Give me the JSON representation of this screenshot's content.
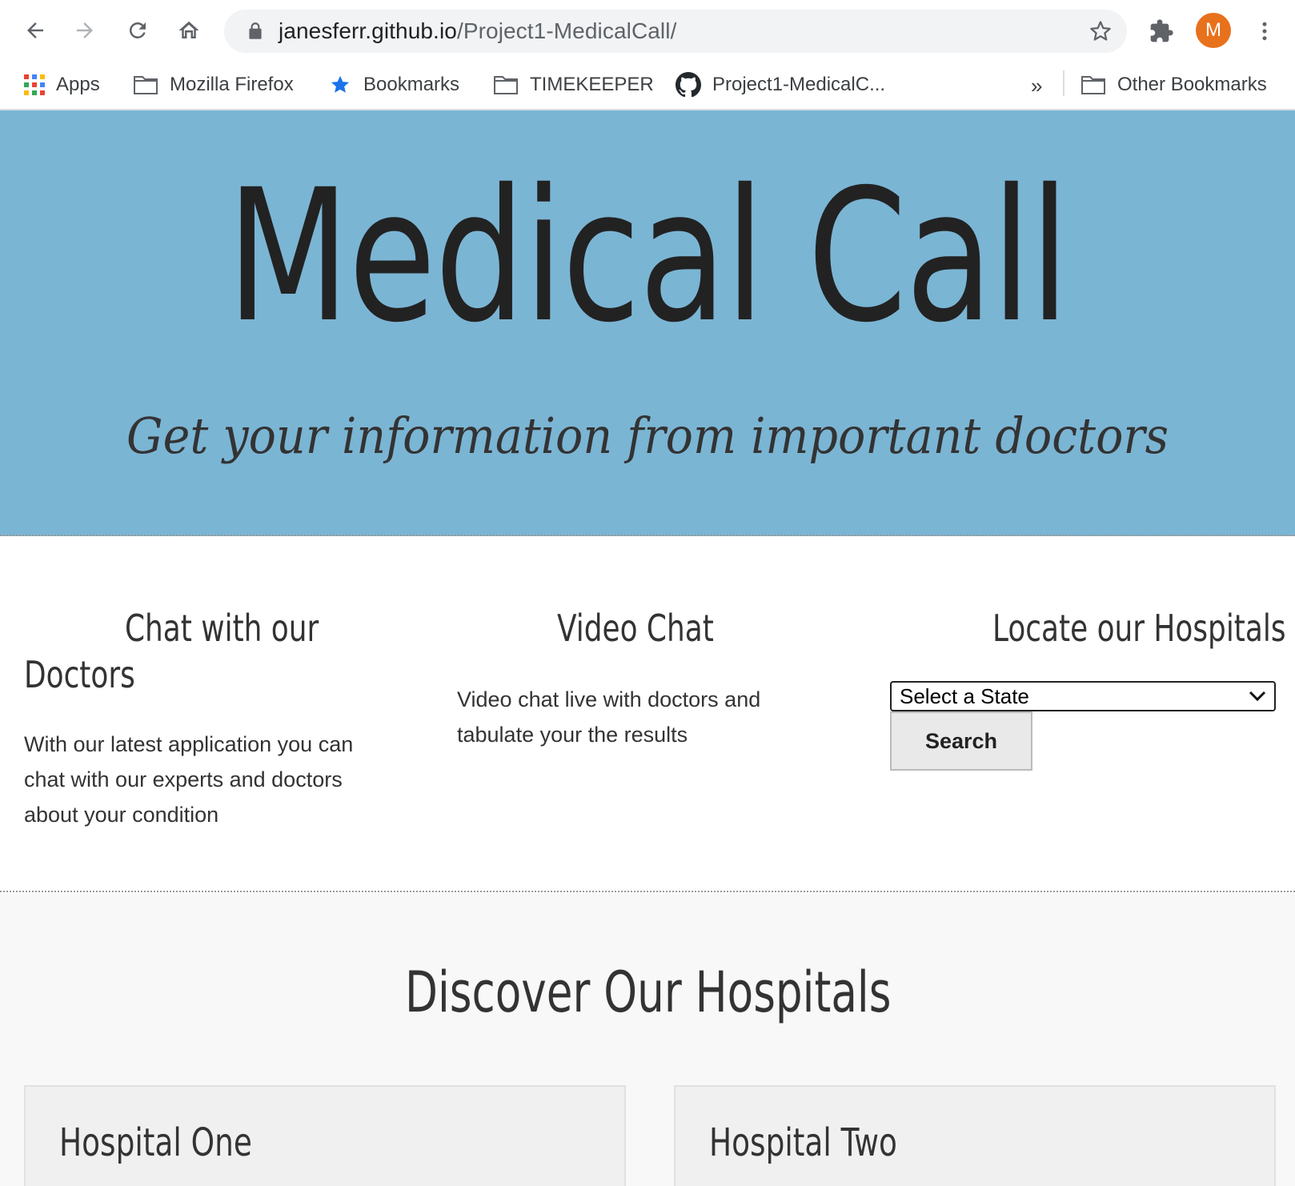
{
  "browser": {
    "url_host": "janesferr.github.io",
    "url_path": "/Project1-MedicalCall/",
    "profile_initial": "M",
    "profile_color": "#e8711c",
    "bookmarks": [
      {
        "label": "Apps",
        "icon": "apps-grid-icon"
      },
      {
        "label": "Mozilla Firefox",
        "icon": "folder-icon"
      },
      {
        "label": "Bookmarks",
        "icon": "star-icon"
      },
      {
        "label": "TIMEKEEPER",
        "icon": "folder-icon"
      },
      {
        "label": "Project1-MedicalC...",
        "icon": "github-icon"
      }
    ],
    "more_bookmarks": "»",
    "other_bookmarks": "Other Bookmarks"
  },
  "hero": {
    "title": "Medical Call",
    "subtitle": "Get your information from important doctors",
    "background": "#7bb5d4"
  },
  "features": {
    "chat": {
      "title_line1": "Chat with our",
      "title_line2": "Doctors",
      "text": "With our latest application you can chat with our experts and doctors about your condition"
    },
    "video": {
      "title": "Video Chat",
      "text": "Video chat live with doctors and tabulate your the results"
    },
    "locate": {
      "title": "Locate our Hospitals",
      "select_value": "Select a State",
      "search_label": "Search"
    }
  },
  "discover": {
    "title": "Discover Our Hospitals",
    "cards": [
      {
        "title": "Hospital One"
      },
      {
        "title": "Hospital Two"
      }
    ]
  }
}
